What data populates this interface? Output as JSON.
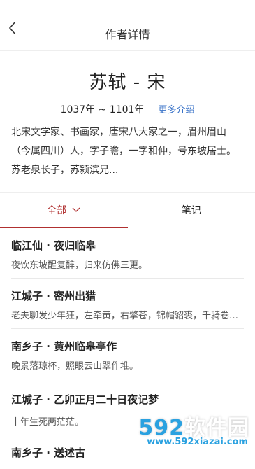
{
  "header": {
    "title": "作者详情",
    "back_icon": "chevron-left-icon"
  },
  "author": {
    "name": "苏轼 - 宋",
    "years": "1037年 ~ 1101年",
    "more_label": "更多介绍",
    "bio": "北宋文学家、书画家，唐宋八大家之一，眉州眉山（今属四川）人，字子瞻，一字和仲，号东坡居士。苏老泉长子，苏颍滨兄..."
  },
  "tabs": [
    {
      "label": "全部",
      "active": true,
      "icon": "chevron-down-icon"
    },
    {
      "label": "笔记",
      "active": false
    }
  ],
  "poems": [
    {
      "title": "临江仙 · 夜归临皋",
      "excerpt": "夜饮东坡醒复醉，归来仿佛三更。"
    },
    {
      "title": "江城子 · 密州出猎",
      "excerpt": "老夫聊发少年狂，左牵黄，右擎苍，锦帽貂裘，千骑卷平冈。"
    },
    {
      "title": "南乡子 · 黄州临皋亭作",
      "excerpt": "晚景落琼杯，照眼云山翠作堆。"
    },
    {
      "title": "江城子 · 乙卯正月二十日夜记梦",
      "excerpt": "十年生死两茫茫。"
    },
    {
      "title": "南乡子 · 送述古",
      "excerpt": ""
    }
  ],
  "watermark": {
    "main_prefix": "592",
    "main_suffix": "软件园",
    "sub": "www.592xiazai.com"
  },
  "colors": {
    "accent": "#b03030",
    "link": "#3a73c8",
    "watermark": "#2aa1e0"
  }
}
